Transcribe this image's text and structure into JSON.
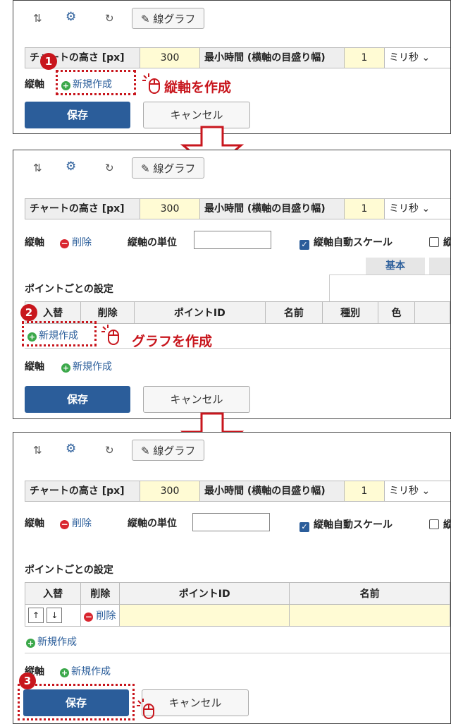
{
  "toolbar": {
    "swap_icon": "⇅",
    "gear_icon": "⚙",
    "refresh_icon": "↻",
    "chart_button": "✎ 線グラフ"
  },
  "settings": {
    "chart_height_label": "チャートの高さ [px]",
    "chart_height_value": "300",
    "min_time_label": "最小時間 (横軸の目盛り幅)",
    "min_time_value": "1",
    "unit_select": "ミリ秒 ⌄"
  },
  "axis": {
    "label": "縦軸",
    "new": "新規作成",
    "delete": "削除",
    "unit_label": "縦軸の単位",
    "auto_scale": "縦軸自動スケール",
    "cut_char": "縦"
  },
  "tabs": {
    "basic": "基本"
  },
  "points": {
    "title": "ポイントごとの設定",
    "headers": {
      "swap": "入替",
      "delete": "削除",
      "point_id": "ポイントID",
      "name": "名前",
      "type": "種別",
      "color": "色"
    },
    "new": "新規作成",
    "row_delete": "削除",
    "up": "↑",
    "down": "↓"
  },
  "buttons": {
    "save": "保存",
    "cancel": "キャンセル"
  },
  "annotations": {
    "step1": "1",
    "step2": "2",
    "step3": "3",
    "callout1": "縦軸を作成",
    "callout2": "グラフを作成"
  },
  "colors": {
    "accent_red": "#c8161d",
    "primary_blue": "#2b5d9a",
    "highlight_yellow": "#fffbd4"
  }
}
